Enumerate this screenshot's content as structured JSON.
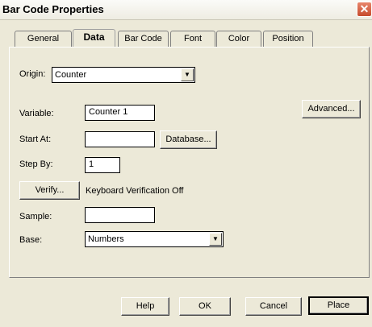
{
  "window": {
    "title": "Bar Code Properties",
    "close_label": "✕"
  },
  "tabs": [
    {
      "label": "General"
    },
    {
      "label": "Data"
    },
    {
      "label": "Bar Code"
    },
    {
      "label": "Font"
    },
    {
      "label": "Color"
    },
    {
      "label": "Position"
    }
  ],
  "data_tab": {
    "origin_label": "Origin:",
    "origin_value": "Counter",
    "variable_label": "Variable:",
    "variable_value": "Counter 1",
    "advanced_button": "Advanced...",
    "start_at_label": "Start At:",
    "start_at_value": "",
    "database_button": "Database...",
    "step_by_label": "Step By:",
    "step_by_value": "1",
    "verify_button": "Verify...",
    "verify_status": "Keyboard Verification Off",
    "sample_label": "Sample:",
    "sample_value": "",
    "base_label": "Base:",
    "base_value": "Numbers"
  },
  "footer": {
    "help": "Help",
    "ok": "OK",
    "cancel": "Cancel",
    "place": "Place"
  },
  "colors": {
    "face": "#ece9d8",
    "close_button": "#d1573b"
  }
}
